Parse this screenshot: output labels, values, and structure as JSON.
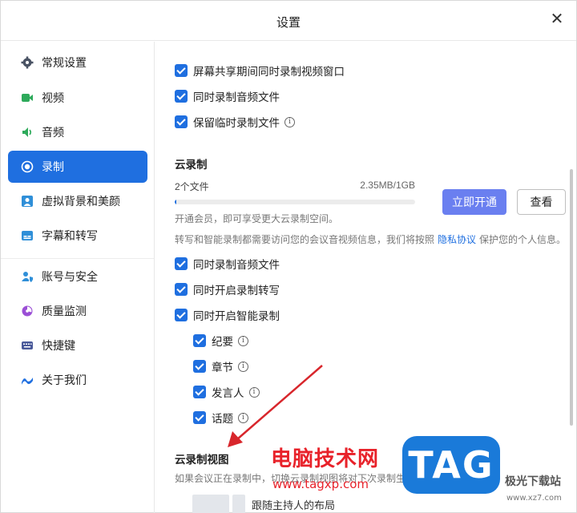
{
  "window": {
    "title": "设置",
    "close_icon": "close-icon"
  },
  "sidebar": {
    "items": [
      {
        "label": "常规设置",
        "icon": "gear-icon"
      },
      {
        "label": "视频",
        "icon": "video-camera-icon"
      },
      {
        "label": "音频",
        "icon": "speaker-icon"
      },
      {
        "label": "录制",
        "icon": "record-icon",
        "active": true
      },
      {
        "label": "虚拟背景和美颜",
        "icon": "portrait-icon"
      },
      {
        "label": "字幕和转写",
        "icon": "subtitle-icon"
      },
      {
        "label": "账号与安全",
        "icon": "user-shield-icon"
      },
      {
        "label": "质量监测",
        "icon": "monitor-gauge-icon"
      },
      {
        "label": "快捷键",
        "icon": "keyboard-icon"
      },
      {
        "label": "关于我们",
        "icon": "about-logo-icon"
      }
    ]
  },
  "local": {
    "options": [
      {
        "label": "屏幕共享期间同时录制视频窗口",
        "checked": true
      },
      {
        "label": "同时录制音频文件",
        "checked": true
      },
      {
        "label": "保留临时录制文件",
        "checked": true,
        "info": true
      }
    ]
  },
  "cloud": {
    "title": "云录制",
    "file_count": "2个文件",
    "usage": "2.35MB/1GB",
    "usage_fraction": 0.0023,
    "upgrade_button": "立即开通",
    "view_button": "查看",
    "hint": "开通会员，即可享受更大云录制空间。",
    "privacy_before": "转写和智能录制都需要访问您的会议音视频信息，我们将按照",
    "privacy_link": "隐私协议",
    "privacy_after": "保护您的个人信息。",
    "options": [
      {
        "label": "同时录制音频文件",
        "checked": true
      },
      {
        "label": "同时开启录制转写",
        "checked": true
      },
      {
        "label": "同时开启智能录制",
        "checked": true
      }
    ],
    "sub_options": [
      {
        "label": "纪要",
        "checked": true,
        "info": true
      },
      {
        "label": "章节",
        "checked": true,
        "info": true
      },
      {
        "label": "发言人",
        "checked": true,
        "info": true
      },
      {
        "label": "话题",
        "checked": true,
        "info": true
      }
    ]
  },
  "cloud_view": {
    "title": "云录制视图",
    "desc": "如果会议正在录制中，切换云录制视图将对下次录制生效",
    "layout_option": "跟随主持人的布局"
  },
  "watermark": {
    "site_name": "电脑技术网",
    "site_url": "www.tagxp.com",
    "logo_text": "TAG",
    "corner_text": "极光下载站",
    "corner_url": "www.xz7.com"
  },
  "colors": {
    "accent": "#1f6fe0",
    "primary_button": "#6a7ff0",
    "watermark_red": "#e8222a",
    "logo_blue": "#1a7ad9"
  }
}
